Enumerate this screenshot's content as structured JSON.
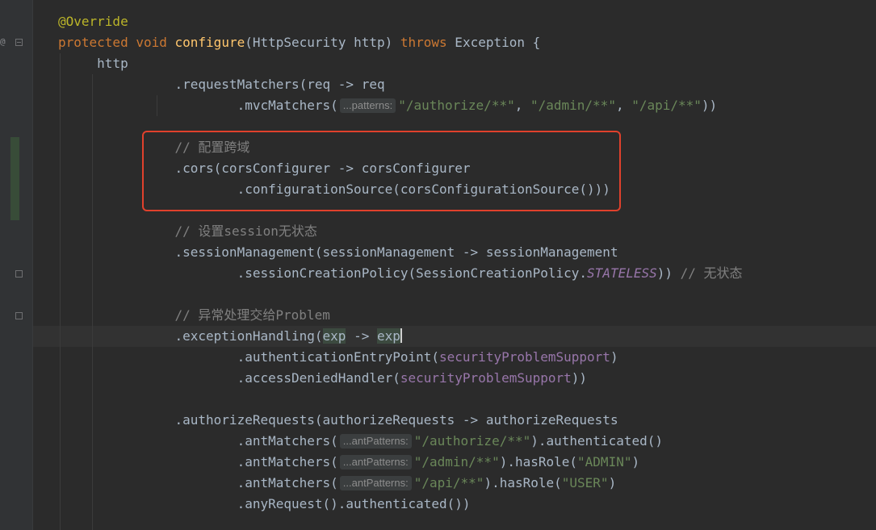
{
  "gutter": {
    "override_marker": "@",
    "icons": [
      "override-icon",
      "fold-icon"
    ]
  },
  "highlight_box_color": "#e0412c",
  "code": {
    "l1": {
      "annotation": "@Override"
    },
    "l2": {
      "kw1": "protected",
      "kw2": "void",
      "method": "configure",
      "p1": "(HttpSecurity http) ",
      "kw3": "throws",
      "p2": " Exception {"
    },
    "l3": {
      "text": "http"
    },
    "l4": {
      "text": ".requestMatchers(req -> req"
    },
    "l5": {
      "pre": ".mvcMatchers(",
      "hint": "...patterns:",
      "s1": "\"/authorize/**\"",
      "c1": ", ",
      "s2": "\"/admin/**\"",
      "c2": ", ",
      "s3": "\"/api/**\"",
      "post": "))"
    },
    "l6": {
      "comment": "// 配置跨域"
    },
    "l7": {
      "text": ".cors(corsConfigurer -> corsConfigurer"
    },
    "l8": {
      "text": ".configurationSource(corsConfigurationSource()))"
    },
    "l9": {
      "comment": "// 设置session无状态"
    },
    "l10": {
      "text": ".sessionManagement(sessionManagement -> sessionManagement"
    },
    "l11": {
      "pre": ".sessionCreationPolicy(SessionCreationPolicy.",
      "constant": "STATELESS",
      "post": ")) ",
      "comment": "// 无状态"
    },
    "l12": {
      "comment": "// 异常处理交给Problem"
    },
    "l13": {
      "pre": ".exceptionHandling(",
      "v1": "exp",
      "arrow": " -> ",
      "v2": "exp"
    },
    "l14": {
      "pre": ".authenticationEntryPoint(",
      "field": "securityProblemSupport",
      "post": ")"
    },
    "l15": {
      "pre": ".accessDeniedHandler(",
      "field": "securityProblemSupport",
      "post": "))"
    },
    "l16": {
      "text": ".authorizeRequests(authorizeRequests -> authorizeRequests"
    },
    "l17": {
      "pre": ".antMatchers(",
      "hint": "...antPatterns:",
      "str": "\"/authorize/**\"",
      "post": ").authenticated()"
    },
    "l18": {
      "pre": ".antMatchers(",
      "hint": "...antPatterns:",
      "str": "\"/admin/**\"",
      "mid": ").hasRole(",
      "role": "\"ADMIN\"",
      "post": ")"
    },
    "l19": {
      "pre": ".antMatchers(",
      "hint": "...antPatterns:",
      "str": "\"/api/**\"",
      "mid": ").hasRole(",
      "role": "\"USER\"",
      "post": ")"
    },
    "l20": {
      "text": ".anyRequest().authenticated())"
    }
  }
}
